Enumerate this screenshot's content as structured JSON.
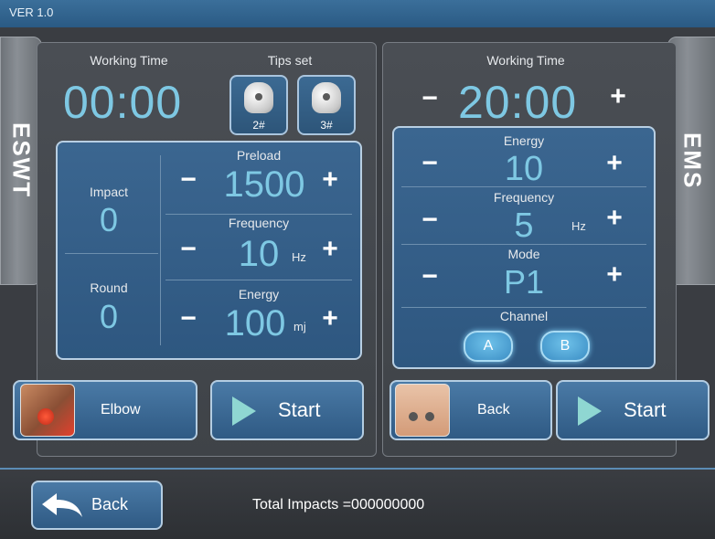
{
  "app": {
    "version": "VER 1.0"
  },
  "eswt": {
    "tab": "ESWT",
    "working_time_label": "Working Time",
    "working_time": "00:00",
    "tips_label": "Tips set",
    "tips": [
      "2#",
      "3#"
    ],
    "impact_label": "Impact",
    "impact": "0",
    "round_label": "Round",
    "round": "0",
    "preload_label": "Preload",
    "preload": "1500",
    "frequency_label": "Frequency",
    "frequency": "10",
    "frequency_unit": "Hz",
    "energy_label": "Energy",
    "energy": "100",
    "energy_unit": "mj",
    "body_part": "Elbow",
    "start_label": "Start"
  },
  "ems": {
    "tab": "EMS",
    "working_time_label": "Working Time",
    "working_time": "20:00",
    "energy_label": "Energy",
    "energy": "10",
    "frequency_label": "Frequency",
    "frequency": "5",
    "frequency_unit": "Hz",
    "mode_label": "Mode",
    "mode": "P1",
    "channel_label": "Channel",
    "channels": [
      "A",
      "B"
    ],
    "body_part": "Back",
    "start_label": "Start"
  },
  "controls": {
    "minus": "−",
    "plus": "+"
  },
  "footer": {
    "back_label": "Back",
    "total_impacts": "Total Impacts =000000000"
  },
  "colors": {
    "accent": "#7ec8e3",
    "panel_blue": "#2e5780"
  }
}
